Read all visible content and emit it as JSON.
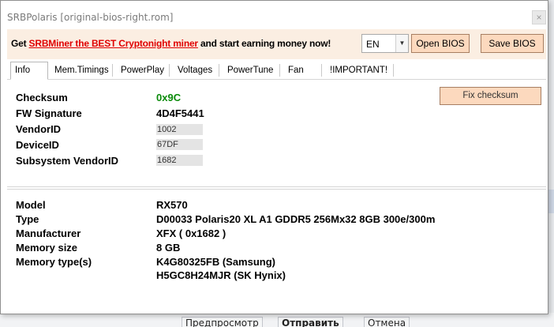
{
  "window": {
    "title": "SRBPolaris [original-bios-right.rom]",
    "close_glyph": "×"
  },
  "banner": {
    "prefix": "Get ",
    "link": "SRBMiner the BEST Cryptonight miner",
    "suffix": " and start earning money now!",
    "link_color": "#e00000",
    "background": "#fbeee2"
  },
  "toolbar": {
    "language": {
      "selected": "EN",
      "arrow": "▼"
    },
    "open_bios": "Open BIOS",
    "save_bios": "Save BIOS",
    "button_color": "#fcd9be"
  },
  "tabs": [
    {
      "label": "Info",
      "active": true
    },
    {
      "label": "Mem.Timings",
      "active": false
    },
    {
      "label": "PowerPlay",
      "active": false
    },
    {
      "label": "Voltages",
      "active": false
    },
    {
      "label": "PowerTune",
      "active": false
    },
    {
      "label": "Fan",
      "active": false
    },
    {
      "label": "!IMPORTANT!",
      "active": false
    }
  ],
  "info": {
    "checksum": {
      "label": "Checksum",
      "value": "0x9C",
      "color": "#0a8a0a"
    },
    "fw_signature": {
      "label": "FW Signature",
      "value": "4D4F5441"
    },
    "vendor_id": {
      "label": "VendorID",
      "value": "1002"
    },
    "device_id": {
      "label": "DeviceID",
      "value": "67DF"
    },
    "subsystem_vendor_id": {
      "label": "Subsystem VendorID",
      "value": "1682"
    },
    "fix_checksum": "Fix checksum"
  },
  "details": {
    "model": {
      "label": "Model",
      "value": "RX570"
    },
    "type": {
      "label": "Type",
      "value": "D00033 Polaris20 XL A1 GDDR5 256Mx32 8GB 300e/300m"
    },
    "manufacturer": {
      "label": "Manufacturer",
      "value": "XFX ( 0x1682 )"
    },
    "memory_size": {
      "label": "Memory size",
      "value": "8 GB"
    },
    "memory_types": {
      "label": "Memory type(s)",
      "values": [
        "K4G80325FB (Samsung)",
        "H5GC8H24MJR (SK Hynix)"
      ]
    }
  },
  "background_page": {
    "buttons": [
      "Предпросмотр",
      "Отправить",
      "Отмена"
    ]
  }
}
